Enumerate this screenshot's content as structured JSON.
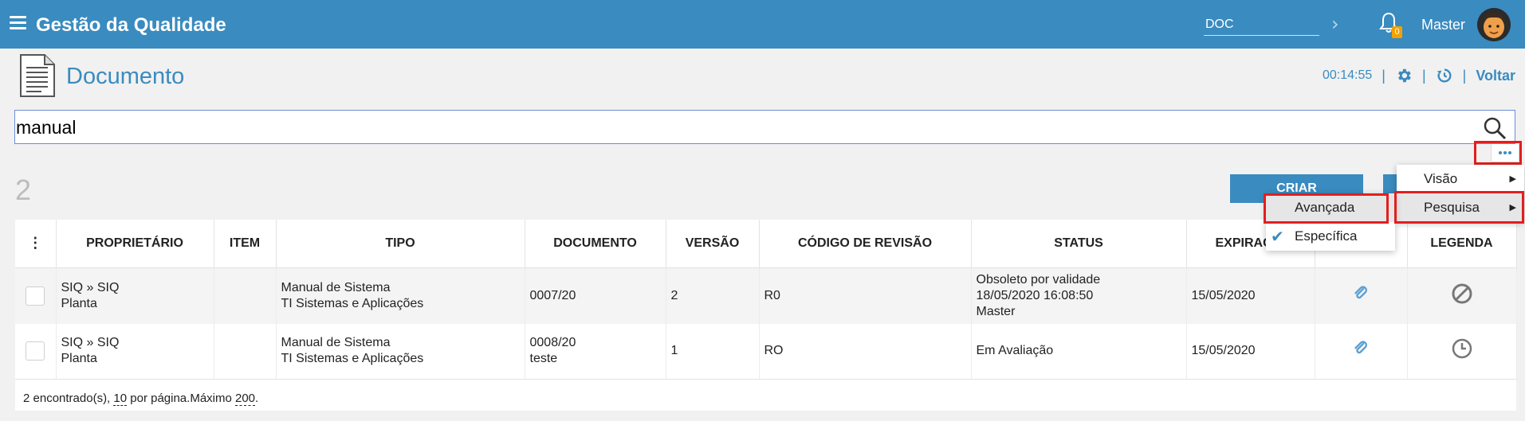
{
  "app": {
    "title": "Gestão da Qualidade"
  },
  "topbar": {
    "doc_value": "DOC",
    "notification_count": "0",
    "user_name": "Master"
  },
  "page": {
    "title": "Documento",
    "timer": "00:14:55",
    "back_label": "Voltar"
  },
  "search": {
    "value": "manual"
  },
  "results": {
    "count": "2"
  },
  "buttons": {
    "create_label": "CRIAR"
  },
  "menu": {
    "items": [
      {
        "label": "Visão"
      },
      {
        "label": "Pesquisa"
      }
    ],
    "pesquisa_submenu": [
      {
        "label": "Avançada"
      },
      {
        "label": "Específica",
        "checked": true
      }
    ]
  },
  "table": {
    "columns": [
      "PROPRIETÁRIO",
      "ITEM",
      "TIPO",
      "DOCUMENTO",
      "VERSÃO",
      "CÓDIGO DE REVISÃO",
      "STATUS",
      "EXPIRAÇ",
      "",
      "LEGENDA"
    ],
    "rows": [
      {
        "owner_line1": "SIQ » SIQ",
        "owner_line2": "Planta",
        "item": "",
        "type_line1": "Manual de Sistema",
        "type_line2": "TI Sistemas e Aplicações",
        "doc_line1": "0007/20",
        "doc_line2": "",
        "version": "2",
        "revision_code": "R0",
        "status_line1": "Obsoleto por validade",
        "status_line2": "18/05/2020 16:08:50",
        "status_line3": "Master",
        "expiration": "15/05/2020",
        "attachment_icon": "paperclip-icon",
        "legend_icon": "blocked-icon"
      },
      {
        "owner_line1": "SIQ » SIQ",
        "owner_line2": "Planta",
        "item": "",
        "type_line1": "Manual de Sistema",
        "type_line2": "TI Sistemas e Aplicações",
        "doc_line1": "0008/20",
        "doc_line2": "teste",
        "version": "1",
        "revision_code": "RO",
        "status_line1": "Em Avaliação",
        "status_line2": "",
        "status_line3": "",
        "expiration": "15/05/2020",
        "attachment_icon": "paperclip-icon",
        "legend_icon": "clock-icon"
      }
    ]
  },
  "footer": {
    "found_text": "2 encontrado(s), ",
    "per_page": "10",
    "per_page_text": " por página.Máximo ",
    "max": "200",
    "end": "."
  },
  "colors": {
    "primary": "#3a8bbf",
    "highlight": "#e31e1e",
    "badge": "#f4a100"
  }
}
